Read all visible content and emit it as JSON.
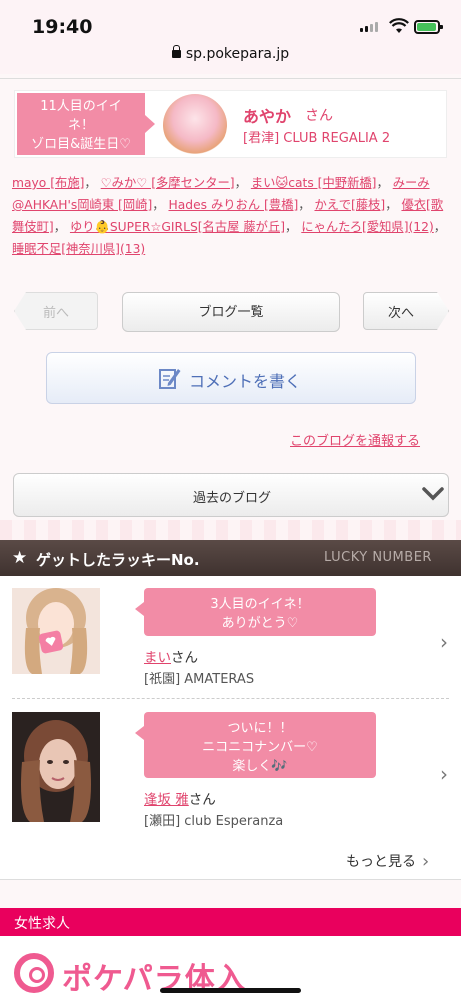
{
  "status": {
    "time": "19:40",
    "url": "sp.pokepara.jp"
  },
  "banner": {
    "badge_line1": "11人目のイイ",
    "badge_line2": "ネ！",
    "badge_line3": "ゾロ目&誕生日♡",
    "name": "あやか",
    "honorific": "さん",
    "shop": "[君津] CLUB REGALIA 2"
  },
  "likes": [
    "mayo [布施]",
    "♡みか♡ [多摩センター]",
    "まい🐱cats [中野新橋]",
    "みーみ@AHKAH's岡崎東 [岡崎]",
    "Hades みりおん [豊橋]",
    "かえで[藤枝]",
    "優衣[歌舞伎町]",
    "ゆり👶SUPER☆GIRLS[名古屋 藤が丘]",
    "にゃんたろ[愛知県](12)",
    "睡眠不足[神奈川県](13)"
  ],
  "nav": {
    "prev": "前へ",
    "list": "ブログ一覧",
    "next": "次へ"
  },
  "comment_button": "コメントを書く",
  "report_link": "このブログを通報する",
  "past_blog": "過去のブログ",
  "lucky": {
    "title": "ゲットしたラッキーNo.",
    "title_en": "LUCKY NUMBER",
    "entries": [
      {
        "bubble_line1": "3人目のイイネ！",
        "bubble_line2": "ありがとう♡",
        "bubble_line3": "",
        "name": "まい",
        "honorific": "さん",
        "shop": "[祇園] AMATERAS"
      },
      {
        "bubble_line1": "ついに！！",
        "bubble_line2": "ニコニコナンバー♡",
        "bubble_line3": "楽しく🎶",
        "name": "逢坂 雅",
        "honorific": "さん",
        "shop": "[瀬田] club Esperanza"
      }
    ],
    "more": "もっと見る"
  },
  "jobs": {
    "header": "女性求人",
    "logo_text": "ポケパラ体入"
  },
  "colors": {
    "accent_pink": "#e0446d",
    "badge_pink": "#f28ca6",
    "jobs_magenta": "#e9005d",
    "lucky_brown": "#4a3c38"
  }
}
